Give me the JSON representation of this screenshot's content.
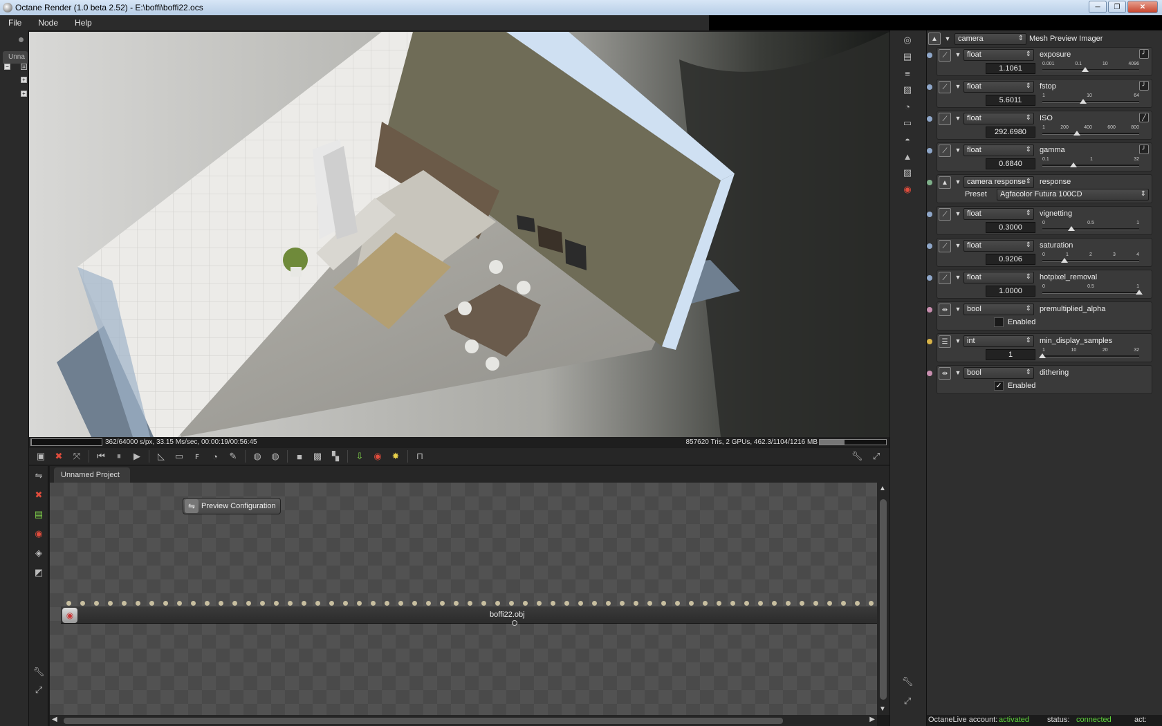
{
  "window": {
    "title": "Octane Render (1.0 beta 2.52) - E:\\boffi\\boffi22.ocs",
    "buttons": [
      "─",
      "❐",
      "✕"
    ]
  },
  "menubar": {
    "items": [
      "File",
      "Node",
      "Help"
    ]
  },
  "left_panel": {
    "tab_label": "Unna"
  },
  "viewport": {
    "render_stats": "362/64000 s/px, 33.15 Ms/sec, 00:00:19/00:56:45",
    "scene_stats": "857620 Tris, 2 GPUs, 462.3/1104/1216 MB",
    "render_progress": 0.006,
    "memory_usage": 0.38
  },
  "node_graph": {
    "tab": "Unnamed Project",
    "preview_node": "Preview Configuration",
    "mesh_node": "boffi22.obj",
    "mesh_pin_count": 77
  },
  "inspector": {
    "header": {
      "type": "camera",
      "label": "Mesh Preview Imager"
    },
    "params": [
      {
        "dot": "#8fa7c9",
        "type": "float",
        "name": "exposure",
        "value": "1.1061",
        "ticks": [
          "0.001",
          "0.1",
          "10",
          "4096"
        ],
        "fraction": 0.44,
        "curve": "╯"
      },
      {
        "dot": "#8fa7c9",
        "type": "float",
        "name": "fstop",
        "value": "5.6011",
        "ticks": [
          "1",
          "10",
          "64"
        ],
        "fraction": 0.42,
        "curve": "╯"
      },
      {
        "dot": "#8fa7c9",
        "type": "float",
        "name": "ISO",
        "value": "292.6980",
        "ticks": [
          "1",
          "200",
          "400",
          "600",
          "800"
        ],
        "fraction": 0.36,
        "curve": "╱"
      },
      {
        "dot": "#8fa7c9",
        "type": "float",
        "name": "gamma",
        "value": "0.6840",
        "ticks": [
          "0.1",
          "1",
          "32"
        ],
        "fraction": 0.32,
        "curve": "╯"
      },
      {
        "dot": "#7fb08a",
        "type": "camera response",
        "name": "response",
        "preset_label": "Preset",
        "preset": "Agfacolor Futura 100CD"
      },
      {
        "dot": "#8fa7c9",
        "type": "float",
        "name": "vignetting",
        "value": "0.3000",
        "ticks": [
          "0",
          "0.5",
          "1"
        ],
        "fraction": 0.3,
        "curve": ""
      },
      {
        "dot": "#8fa7c9",
        "type": "float",
        "name": "saturation",
        "value": "0.9206",
        "ticks": [
          "0",
          "1",
          "2",
          "3",
          "4"
        ],
        "fraction": 0.23,
        "curve": ""
      },
      {
        "dot": "#8fa7c9",
        "type": "float",
        "name": "hotpixel_removal",
        "value": "1.0000",
        "ticks": [
          "0",
          "0.5",
          "1"
        ],
        "fraction": 1.0,
        "curve": ""
      },
      {
        "dot": "#c98fb0",
        "type": "bool",
        "name": "premultiplied_alpha",
        "check_label": "Enabled",
        "checked": false
      },
      {
        "dot": "#d8b347",
        "type": "int",
        "name": "min_display_samples",
        "value": "1",
        "ticks": [
          "1",
          "10",
          "20",
          "32"
        ],
        "fraction": 0.0,
        "curve": ""
      },
      {
        "dot": "#c98fb0",
        "type": "bool",
        "name": "dithering",
        "check_label": "Enabled",
        "checked": true
      }
    ]
  },
  "status": {
    "account_label": "OctaneLive account:",
    "account_value": "activated",
    "status_label": "status:",
    "status_value": "connected",
    "act_label": "act:"
  }
}
